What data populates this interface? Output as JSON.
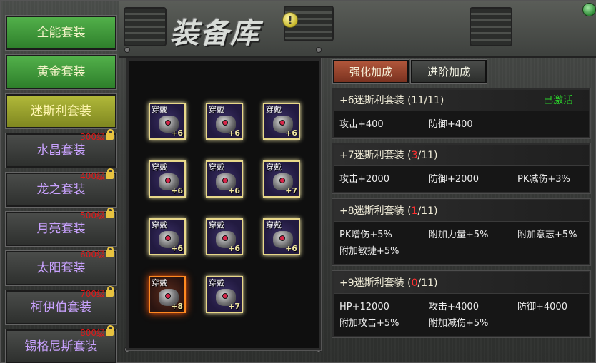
{
  "window": {
    "title": "装备库"
  },
  "sidebar": {
    "items": [
      {
        "label": "全能套装",
        "state": "unlocked",
        "level": ""
      },
      {
        "label": "黄金套装",
        "state": "unlocked",
        "level": ""
      },
      {
        "label": "迷斯利套装",
        "state": "selected",
        "level": ""
      },
      {
        "label": "水晶套装",
        "state": "locked",
        "level": "300级"
      },
      {
        "label": "龙之套装",
        "state": "locked",
        "level": "400级"
      },
      {
        "label": "月亮套装",
        "state": "locked",
        "level": "500级"
      },
      {
        "label": "太阳套装",
        "state": "locked",
        "level": "600级"
      },
      {
        "label": "柯伊伯套装",
        "state": "locked",
        "level": "700级"
      },
      {
        "label": "锡格尼斯套装",
        "state": "locked",
        "level": "800级"
      }
    ]
  },
  "equipment": {
    "slots": [
      {
        "tag": "穿戴",
        "plus": "+6",
        "item_icon": "ring-icon"
      },
      {
        "tag": "穿戴",
        "plus": "+6",
        "item_icon": "ring-icon"
      },
      {
        "tag": "穿戴",
        "plus": "+6",
        "item_icon": "bracelet-icon"
      },
      {
        "tag": "穿戴",
        "plus": "+6",
        "item_icon": "necklace-icon"
      },
      {
        "tag": "穿戴",
        "plus": "+6",
        "item_icon": "helmet-icon"
      },
      {
        "tag": "穿戴",
        "plus": "+7",
        "item_icon": "armor-icon"
      },
      {
        "tag": "穿戴",
        "plus": "+6",
        "item_icon": "glove-icon"
      },
      {
        "tag": "穿戴",
        "plus": "+6",
        "item_icon": "belt-icon"
      },
      {
        "tag": "穿戴",
        "plus": "+6",
        "item_icon": "shoulder-icon"
      },
      {
        "tag": "穿戴",
        "plus": "+8",
        "item_icon": "boots-icon"
      },
      {
        "tag": "穿戴",
        "plus": "+7",
        "item_icon": "weapon-icon"
      }
    ]
  },
  "tabs": {
    "enhance": "强化加成",
    "advance": "进阶加成"
  },
  "bonus": {
    "sets": [
      {
        "title_prefix": "+6迷斯利套装 (",
        "current": "11",
        "title_suffix": "/11)",
        "status": "已激活",
        "stats": [
          "攻击+400",
          "防御+400"
        ]
      },
      {
        "title_prefix": "+7迷斯利套装 (",
        "current": "3",
        "title_suffix": "/11)",
        "status": "",
        "stats": [
          "攻击+2000",
          "防御+2000",
          "PK减伤+3%"
        ]
      },
      {
        "title_prefix": "+8迷斯利套装 (",
        "current": "1",
        "title_suffix": "/11)",
        "status": "",
        "stats": [
          "PK增伤+5%",
          "附加力量+5%",
          "附加意志+5%",
          "附加敏捷+5%"
        ]
      },
      {
        "title_prefix": "+9迷斯利套装 (",
        "current": "0",
        "title_suffix": "/11)",
        "status": "",
        "stats": [
          "HP+12000",
          "攻击+4000",
          "防御+4000",
          "附加攻击+5%",
          "附加减伤+5%"
        ]
      }
    ]
  }
}
